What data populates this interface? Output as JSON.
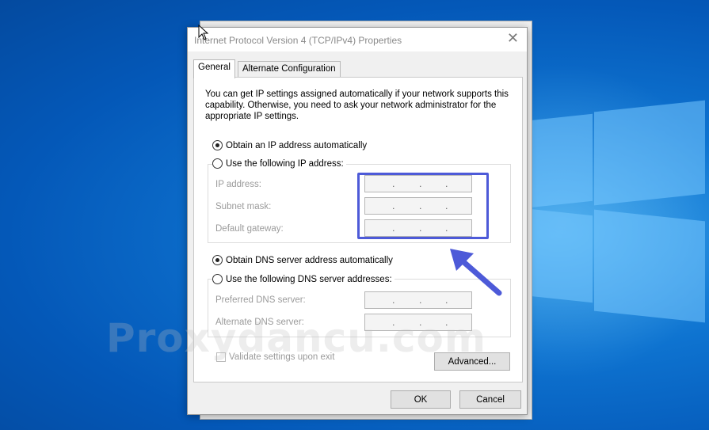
{
  "dialog": {
    "title": "Internet Protocol Version 4 (TCP/IPv4) Properties",
    "close_glyph": "✕",
    "tabs": [
      {
        "label": "General",
        "active": true
      },
      {
        "label": "Alternate Configuration",
        "active": false
      }
    ],
    "intro_text": "You can get IP settings assigned automatically if your network supports this capability. Otherwise, you need to ask your network administrator for the appropriate IP settings.",
    "ip_section": {
      "auto_label": "Obtain an IP address automatically",
      "manual_label": "Use the following IP address:",
      "selected": "auto",
      "fields": [
        {
          "label": "IP address:"
        },
        {
          "label": "Subnet mask:"
        },
        {
          "label": "Default gateway:"
        }
      ]
    },
    "dns_section": {
      "auto_label": "Obtain DNS server address automatically",
      "manual_label": "Use the following DNS server addresses:",
      "selected": "auto",
      "fields": [
        {
          "label": "Preferred DNS server:"
        },
        {
          "label": "Alternate DNS server:"
        }
      ]
    },
    "validate_label": "Validate settings upon exit",
    "advanced_label": "Advanced...",
    "ok_label": "OK",
    "cancel_label": "Cancel"
  },
  "watermark": "Proxydancu.com",
  "colors": {
    "highlight": "#4d5ad8",
    "desktop": "#0e73d0"
  }
}
